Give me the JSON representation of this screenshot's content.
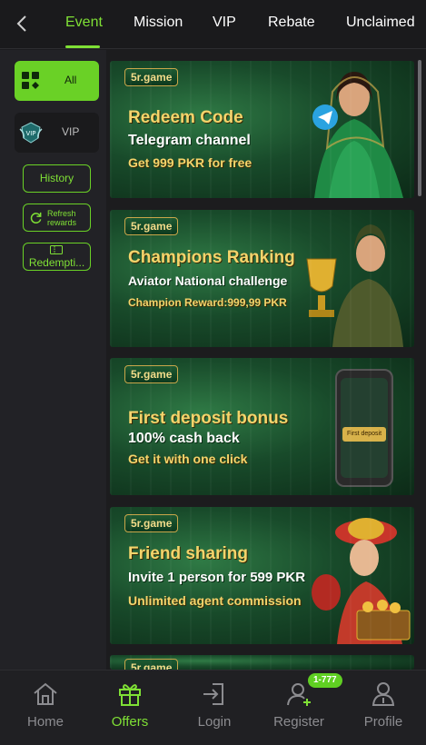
{
  "header": {
    "tabs": [
      {
        "label": "Event",
        "active": true
      },
      {
        "label": "Mission",
        "active": false
      },
      {
        "label": "VIP",
        "active": false
      },
      {
        "label": "Rebate",
        "active": false
      },
      {
        "label": "Unclaimed",
        "active": false
      }
    ]
  },
  "sidebar": {
    "categories": [
      {
        "label": "All",
        "icon": "grid-icon",
        "active": true
      },
      {
        "label": "VIP",
        "icon": "vip-badge-icon",
        "active": false
      }
    ],
    "history_label": "History",
    "refresh_label": "Refresh rewards",
    "redemption_label": "Redempti..."
  },
  "banners": [
    {
      "brand": "5r.game",
      "line1": "Redeem Code",
      "line2": "Telegram channel",
      "line3": "Get 999 PKR for free"
    },
    {
      "brand": "5r.game",
      "line1": "Champions Ranking",
      "line2": "Aviator National challenge",
      "line3": "Champion Reward:999,99 PKR"
    },
    {
      "brand": "5r.game",
      "line1": "First deposit bonus",
      "line2": "100% cash back",
      "line3": "Get it with one click",
      "phone_button": "First deposit"
    },
    {
      "brand": "5r.game",
      "line1": "Friend sharing",
      "line2": "Invite 1 person for 599 PKR",
      "line3": "Unlimited agent commission"
    },
    {
      "brand": "5r.game"
    }
  ],
  "bottom_nav": {
    "items": [
      {
        "label": "Home",
        "icon": "home-icon",
        "active": false
      },
      {
        "label": "Offers",
        "icon": "gift-icon",
        "active": true
      },
      {
        "label": "Login",
        "icon": "login-icon",
        "active": false
      },
      {
        "label": "Register",
        "icon": "add-user-icon",
        "active": false
      },
      {
        "label": "Profile",
        "icon": "profile-icon",
        "active": false
      }
    ],
    "register_badge": "1-777"
  },
  "colors": {
    "accent": "#7fe035",
    "accent_dark": "#6ad126",
    "background": "#1c1c1e",
    "sidebar": "#222226",
    "gold": "#f4d46b"
  }
}
